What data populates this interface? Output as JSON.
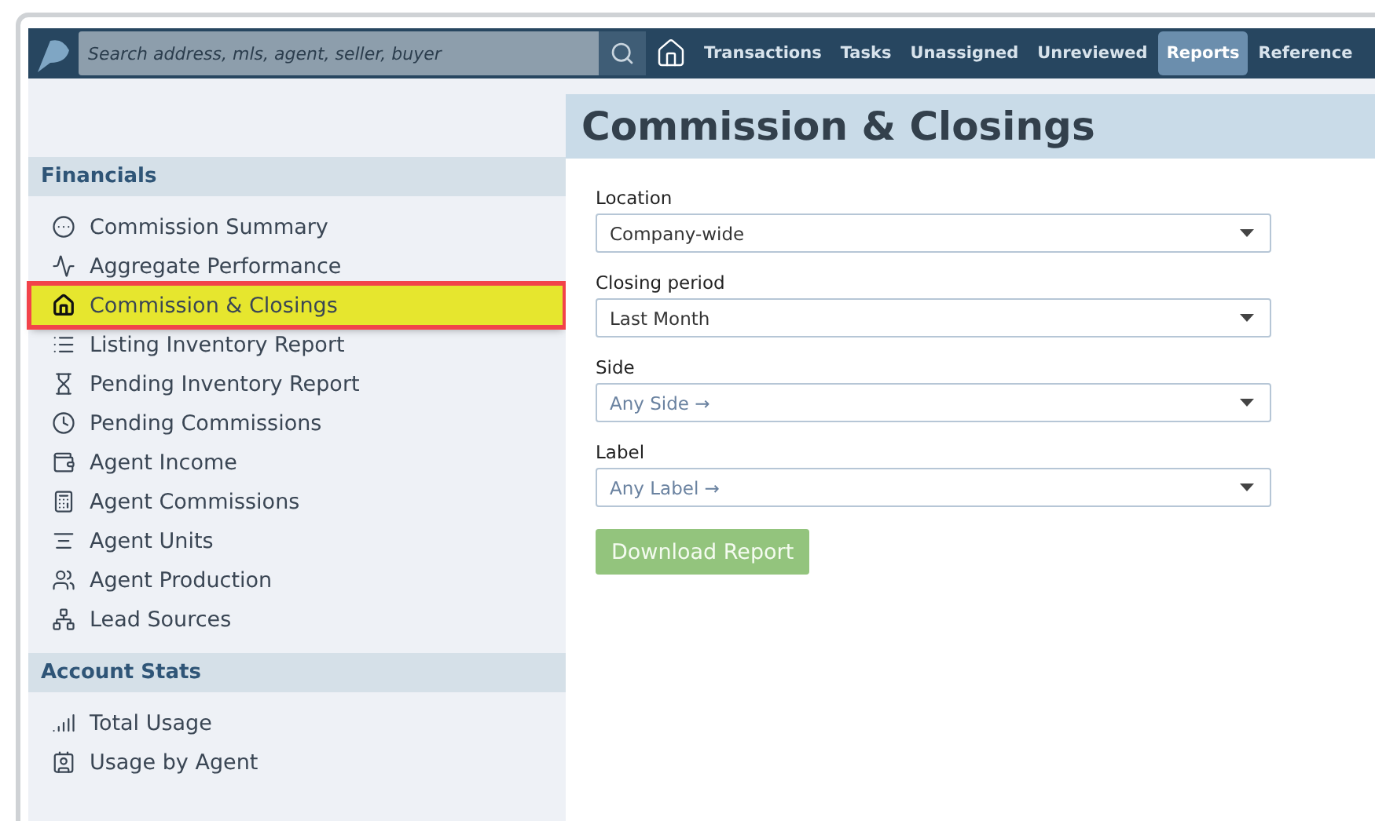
{
  "top_bar": {
    "search": {
      "placeholder": "Search address, mls, agent, seller, buyer"
    },
    "nav": [
      {
        "label": "Transactions",
        "selected": false
      },
      {
        "label": "Tasks",
        "selected": false
      },
      {
        "label": "Unassigned",
        "selected": false
      },
      {
        "label": "Unreviewed",
        "selected": false
      },
      {
        "label": "Reports",
        "selected": true
      },
      {
        "label": "Reference",
        "selected": false
      }
    ]
  },
  "sidebar": {
    "sections": [
      {
        "title": "Financials",
        "items": [
          {
            "label": "Commission Summary",
            "selected": false
          },
          {
            "label": "Aggregate Performance",
            "selected": false
          },
          {
            "label": "Commission & Closings",
            "selected": true
          },
          {
            "label": "Listing Inventory Report",
            "selected": false
          },
          {
            "label": "Pending Inventory Report",
            "selected": false
          },
          {
            "label": "Pending Commissions",
            "selected": false
          },
          {
            "label": "Agent Income",
            "selected": false
          },
          {
            "label": "Agent Commissions",
            "selected": false
          },
          {
            "label": "Agent Units",
            "selected": false
          },
          {
            "label": "Agent Production",
            "selected": false
          },
          {
            "label": "Lead Sources",
            "selected": false
          }
        ]
      },
      {
        "title": "Account Stats",
        "items": [
          {
            "label": "Total Usage",
            "selected": false
          },
          {
            "label": "Usage by Agent",
            "selected": false
          }
        ]
      }
    ]
  },
  "main": {
    "title": "Commission & Closings",
    "fields": [
      {
        "label": "Location",
        "value": "Company-wide"
      },
      {
        "label": "Closing period",
        "value": "Last Month"
      },
      {
        "label": "Side",
        "placeholder": "Any Side →"
      },
      {
        "label": "Label",
        "placeholder": "Any Label →"
      }
    ],
    "button": "Download Report"
  }
}
